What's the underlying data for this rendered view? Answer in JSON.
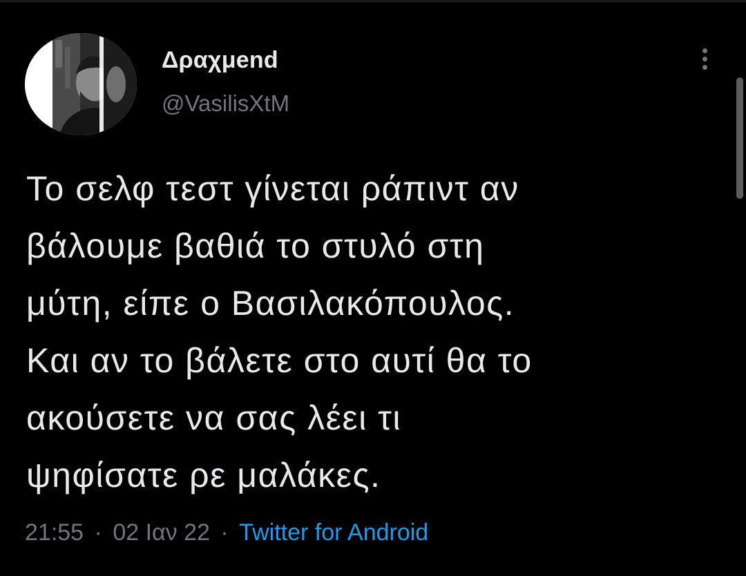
{
  "tweet": {
    "author": {
      "display_name": "Δραχμend",
      "handle": "@VasilisXtM",
      "avatar_icon": "profile-photo-man"
    },
    "more_icon": "more-vertical-icon",
    "text_lines": [
      "Το σελφ τεστ γίνεται ράπιντ αν",
      "βάλουμε βαθιά το στυλό στη",
      "μύτη, είπε ο Βασιλακόπουλος.",
      "Και αν το βάλετε στο αυτί θα το",
      "ακούσετε να σας λέει τι",
      "ψηφίσατε ρε μαλάκες."
    ],
    "meta": {
      "time": "21:55",
      "separator": "·",
      "date": "02 Ιαν 22",
      "source": "Twitter for Android"
    }
  },
  "colors": {
    "background": "#000000",
    "text_primary": "#e7e9ea",
    "text_secondary": "#71767b",
    "link": "#1d9bf0"
  }
}
